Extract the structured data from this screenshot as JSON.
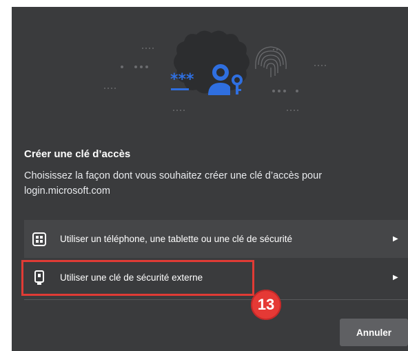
{
  "dialog": {
    "title": "Créer une clé d’accès",
    "description": "Choisissez la façon dont vous souhaitez créer une clé d’accès pour login.microsoft.com",
    "options": [
      {
        "label": "Utiliser un téléphone, une tablette ou une clé de sécurité",
        "icon": "qr-phone-icon"
      },
      {
        "label": "Utiliser une clé de sécurité externe",
        "icon": "usb-key-icon"
      }
    ],
    "cancel_label": "Annuler"
  },
  "annotation": {
    "step_number": "13"
  },
  "colors": {
    "dialog_bg": "#3a3b3d",
    "accent_blue": "#2f6fe0",
    "highlight_red": "#e03b35"
  }
}
